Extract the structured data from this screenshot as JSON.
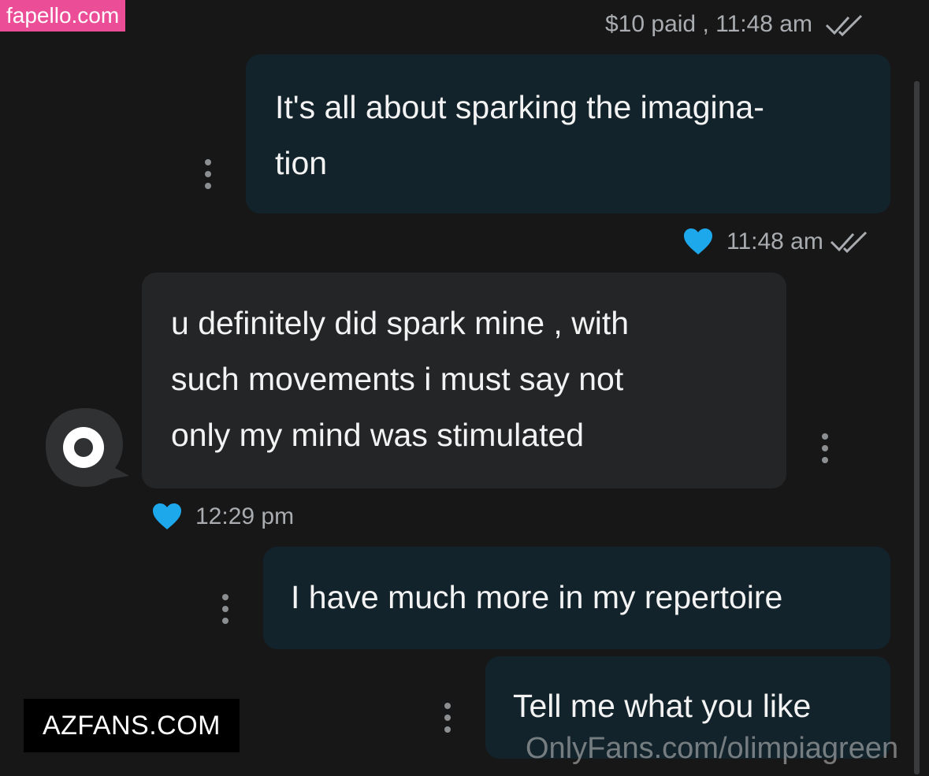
{
  "watermarks": {
    "top_left": "fapello.com",
    "bottom_left": "AZFANS.COM",
    "bottom_right": "OnlyFans.com/olimpiagreen"
  },
  "messages": [
    {
      "direction": "outgoing",
      "status_text": "$10 paid , 11:48 am",
      "status_icon": "double-check-icon",
      "lines": [
        "It's all about sparking the imagina-",
        "tion"
      ]
    },
    {
      "direction": "outgoing_meta",
      "time": "11:48 am",
      "liked": true,
      "status_icon": "double-check-icon"
    },
    {
      "direction": "incoming",
      "avatar_icon": "avatar-icon",
      "lines": [
        "u definitely did spark mine , with",
        "such movements i must say not",
        "only my mind was stimulated"
      ],
      "time": "12:29 pm",
      "liked": true
    },
    {
      "direction": "outgoing",
      "lines": [
        "I have much more in my repertoire"
      ]
    },
    {
      "direction": "outgoing",
      "lines": [
        "Tell me what you like"
      ]
    }
  ],
  "colors": {
    "background": "#171717",
    "outgoing_bubble": "#13232b",
    "incoming_bubble": "#242526",
    "heart": "#1ea8ec",
    "watermark_pink": "#ec4d97"
  }
}
